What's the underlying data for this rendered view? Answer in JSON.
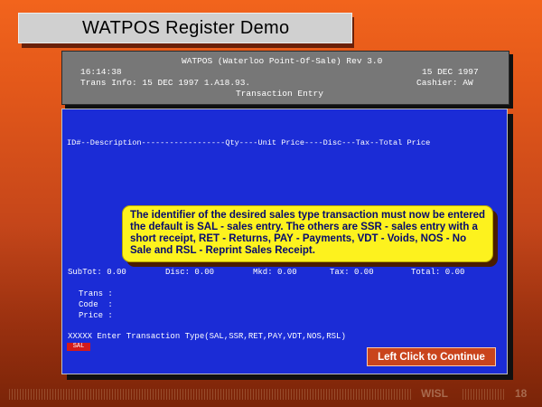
{
  "slide": {
    "title": "WATPOS Register Demo",
    "footer_label": "WISL",
    "page_number": "18"
  },
  "header": {
    "app_title": "WATPOS (Waterloo Point-Of-Sale) Rev 3.0",
    "time": "16:14:38",
    "date": "15 DEC 1997",
    "trans_info": "Trans Info: 15 DEC 1997 1.A18.93.",
    "cashier": "Cashier: AW",
    "screen_name": "Transaction Entry"
  },
  "transaction": {
    "column_header": "ID#--Description------------------Qty----Unit Price----Disc---Tax--Total Price",
    "subtotal": "SubTot: 0.00",
    "disc": "Disc: 0.00",
    "mkd": "Mkd: 0.00",
    "tax": "Tax: 0.00",
    "total": "Total: 0.00",
    "trans_label": "Trans :",
    "code_label": "Code  :",
    "price_label": "Price :",
    "prompt": "XXXXX Enter Transaction Type(SAL,SSR,RET,PAY,VDT,NOS,RSL)",
    "input_value": "SAL"
  },
  "tooltip": {
    "text": "The identifier of the desired sales type transaction must now be entered the default is SAL - sales entry. The others are SSR - sales entry with a short receipt, RET - Returns, PAY - Payments, VDT - Voids, NOS - No Sale and RSL - Reprint Sales Receipt."
  },
  "continue_button": {
    "label": "Left Click to Continue"
  },
  "colors": {
    "screen_background": "#1b2cd6",
    "tooltip_background": "#fdf21e",
    "tooltip_text": "#050a6e",
    "button_background": "#c9441c"
  }
}
